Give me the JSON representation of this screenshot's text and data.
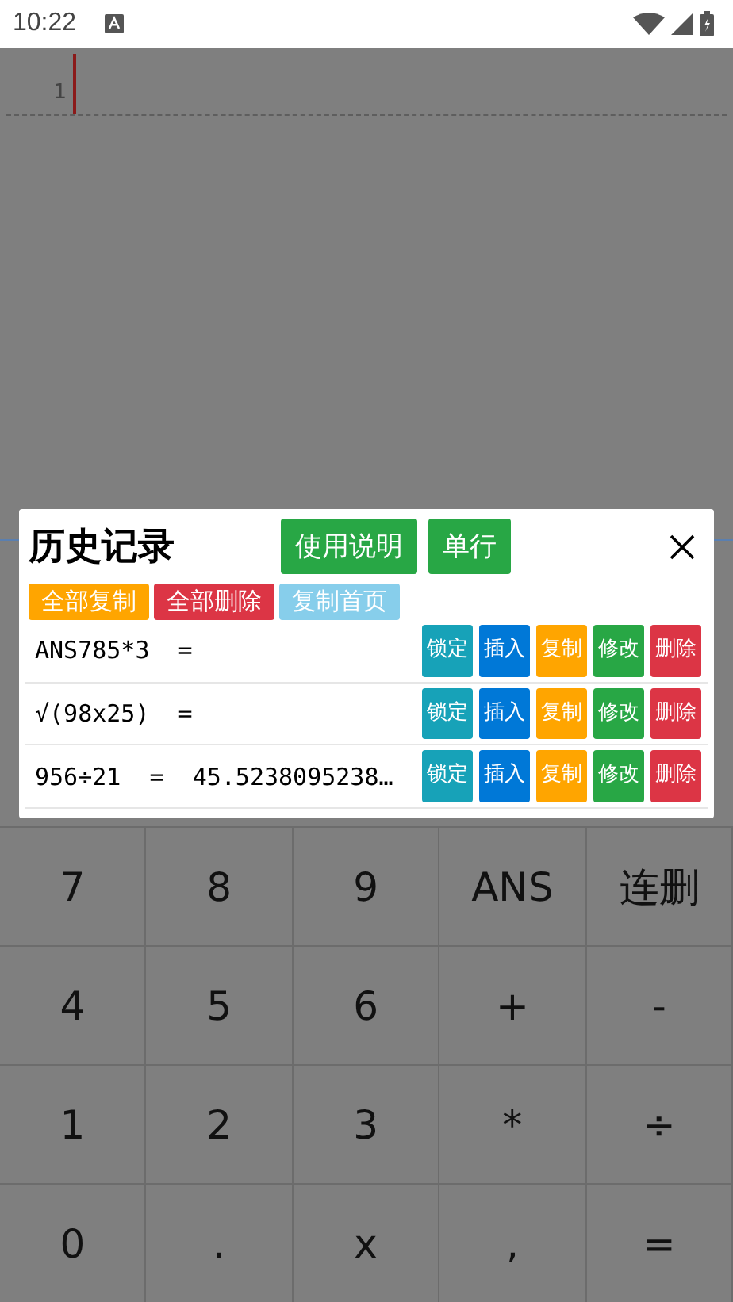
{
  "status_bar": {
    "time": "10:22"
  },
  "editor": {
    "line_numbers": [
      "1"
    ]
  },
  "history_dialog": {
    "title": "历史记录",
    "header_buttons": [
      {
        "label": "使用说明"
      },
      {
        "label": "单行"
      }
    ],
    "action_buttons": [
      {
        "label": "全部复制",
        "kind": "copy"
      },
      {
        "label": "全部删除",
        "kind": "delete"
      },
      {
        "label": "复制首页",
        "kind": "light"
      }
    ],
    "entries": [
      {
        "expression": "ANS785*3  =",
        "buttons": [
          {
            "label": "锁定",
            "kind": "lock"
          },
          {
            "label": "插入",
            "kind": "insert"
          },
          {
            "label": "复制",
            "kind": "copy"
          },
          {
            "label": "修改",
            "kind": "edit"
          },
          {
            "label": "删除",
            "kind": "delete"
          }
        ]
      },
      {
        "expression": "√(98x25)  =",
        "buttons": [
          {
            "label": "锁定",
            "kind": "lock"
          },
          {
            "label": "插入",
            "kind": "insert"
          },
          {
            "label": "复制",
            "kind": "copy"
          },
          {
            "label": "修改",
            "kind": "edit"
          },
          {
            "label": "删除",
            "kind": "delete"
          }
        ]
      },
      {
        "expression": "956÷21  =  45.5238095238…",
        "buttons": [
          {
            "label": "锁定",
            "kind": "lock"
          },
          {
            "label": "插入",
            "kind": "insert"
          },
          {
            "label": "复制",
            "kind": "copy"
          },
          {
            "label": "修改",
            "kind": "edit"
          },
          {
            "label": "删除",
            "kind": "delete"
          }
        ]
      }
    ]
  },
  "keypad": [
    [
      "7",
      "8",
      "9",
      "ANS",
      "连删"
    ],
    [
      "4",
      "5",
      "6",
      "+",
      "-"
    ],
    [
      "1",
      "2",
      "3",
      "*",
      "÷"
    ],
    [
      "0",
      ".",
      "x",
      ",",
      "="
    ]
  ]
}
